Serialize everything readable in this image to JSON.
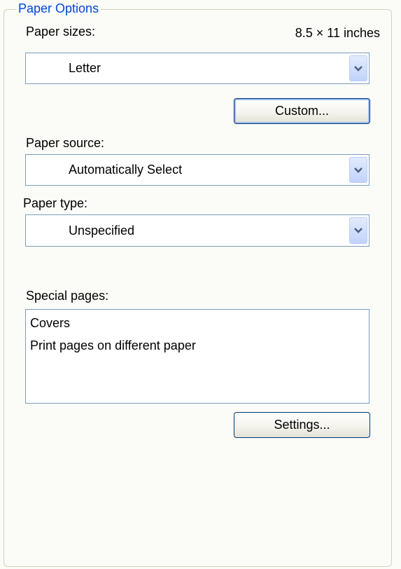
{
  "group": {
    "title": "Paper Options"
  },
  "paper_sizes": {
    "label": "Paper sizes:",
    "dimensions": "8.5 × 11 inches",
    "selected": "Letter"
  },
  "custom_button": {
    "label": "Custom..."
  },
  "paper_source": {
    "label": "Paper source:",
    "selected": "Automatically Select"
  },
  "paper_type": {
    "label": "Paper type:",
    "selected": "Unspecified"
  },
  "special_pages": {
    "label": "Special pages:",
    "items": [
      "Covers",
      "Print pages on different paper"
    ]
  },
  "settings_button": {
    "label": "Settings..."
  },
  "icons": {
    "dropdown": "chevron-down-icon"
  },
  "colors": {
    "group_title": "#0046d5",
    "field_border": "#7f9db9",
    "button_border": "#003c74",
    "dropdown_button": "#c1d3fb",
    "background": "#fbfbf8"
  }
}
